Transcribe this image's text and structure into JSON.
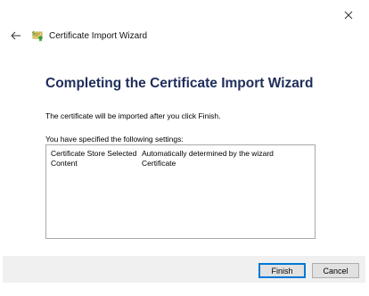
{
  "window": {
    "title": "Certificate Import Wizard",
    "close_icon": "close-icon",
    "back_icon": "back-arrow-icon",
    "app_icon": "certificate-icon"
  },
  "main": {
    "heading": "Completing the Certificate Import Wizard",
    "info": "The certificate will be imported after you click Finish.",
    "settings_label": "You have specified the following settings:",
    "settings": [
      {
        "key": "Certificate Store Selected",
        "value": "Automatically determined by the wizard"
      },
      {
        "key": "Content",
        "value": "Certificate"
      }
    ]
  },
  "footer": {
    "finish_label": "Finish",
    "cancel_label": "Cancel"
  },
  "colors": {
    "heading": "#1f2d5a",
    "footer_bg": "#f0f0f0",
    "accent": "#0078d7"
  }
}
